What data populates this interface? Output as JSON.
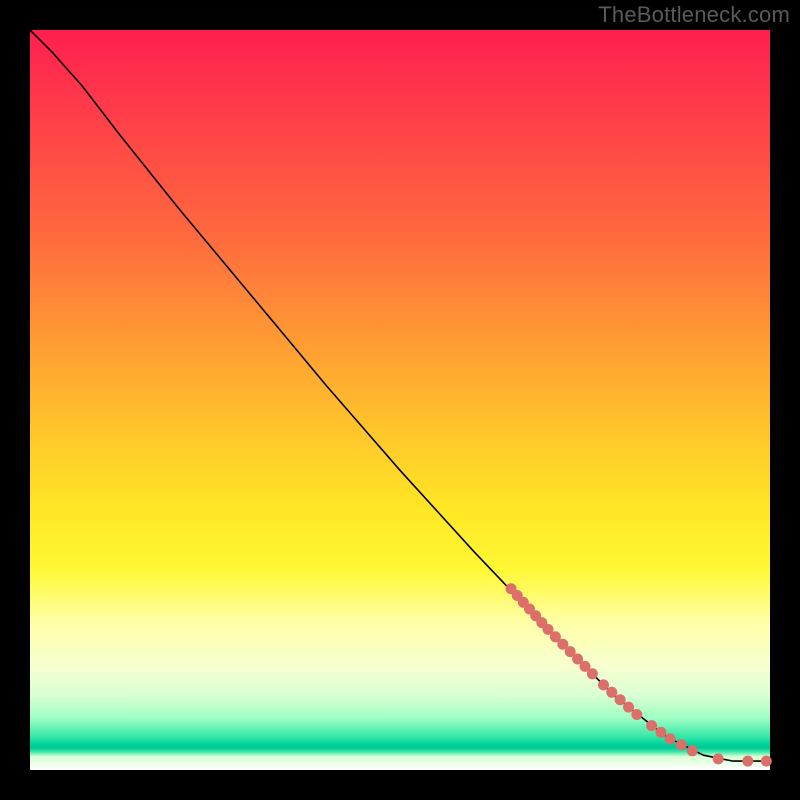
{
  "watermark": "TheBottleneck.com",
  "colors": {
    "dot": "#dd6f6a",
    "curve": "#000000"
  },
  "chart_data": {
    "type": "line",
    "title": "",
    "xlabel": "",
    "ylabel": "",
    "x_range": [
      0,
      100
    ],
    "y_range": [
      0,
      100
    ],
    "note": "no axis ticks or labels are visible; values are estimated fractions of plot area (0-100)",
    "curve": [
      {
        "x": 0,
        "y": 100
      },
      {
        "x": 3,
        "y": 97
      },
      {
        "x": 7,
        "y": 92.5
      },
      {
        "x": 12,
        "y": 86
      },
      {
        "x": 20,
        "y": 76
      },
      {
        "x": 30,
        "y": 64
      },
      {
        "x": 40,
        "y": 52
      },
      {
        "x": 50,
        "y": 40.5
      },
      {
        "x": 60,
        "y": 29.5
      },
      {
        "x": 70,
        "y": 19
      },
      {
        "x": 79,
        "y": 10
      },
      {
        "x": 86,
        "y": 4.5
      },
      {
        "x": 91,
        "y": 2
      },
      {
        "x": 95,
        "y": 1.2
      },
      {
        "x": 100,
        "y": 1.2
      }
    ],
    "dot_clusters": [
      {
        "x_start": 65,
        "x_end": 70,
        "y_start": 24.5,
        "y_end": 19,
        "count": 7
      },
      {
        "x_start": 71,
        "x_end": 76,
        "y_start": 18,
        "y_end": 13,
        "count": 6
      },
      {
        "x_start": 77.5,
        "x_end": 82,
        "y_start": 11.5,
        "y_end": 7.5,
        "count": 5
      },
      {
        "x_start": 84,
        "x_end": 86.5,
        "y_start": 6.0,
        "y_end": 4.2,
        "count": 3
      },
      {
        "x_start": 88,
        "x_end": 89.5,
        "y_start": 3.4,
        "y_end": 2.6,
        "count": 2
      },
      {
        "x_start": 92.5,
        "x_end": 93.5,
        "y_start": 1.6,
        "y_end": 1.4,
        "count": 1
      },
      {
        "x_start": 97,
        "x_end": 99.5,
        "y_start": 1.2,
        "y_end": 1.2,
        "count": 2
      }
    ]
  }
}
